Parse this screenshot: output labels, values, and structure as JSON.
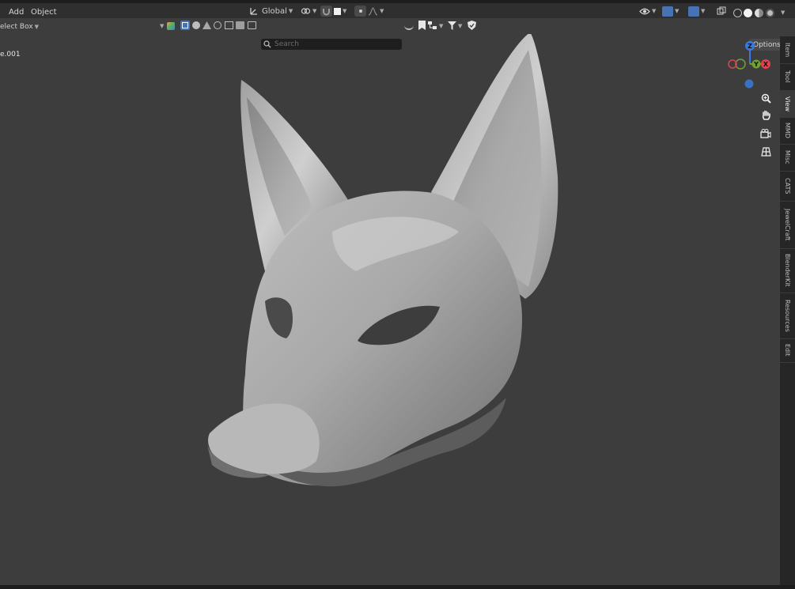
{
  "header": {
    "menu_add": "Add",
    "menu_object": "Object",
    "transform_orientation": "Global",
    "select_mode": "elect Box",
    "search_placeholder": "Search",
    "options_label": "Options"
  },
  "viewport": {
    "object_name": "e.001",
    "background_color": "#3d3d3d",
    "navigation_gizmo": {
      "z_label": "Z",
      "y_label": "Y",
      "x_label": "X",
      "x_color": "#e0414d",
      "y_color": "#6fa42a",
      "z_color": "#3b7ad9"
    }
  },
  "sidebar_tabs": [
    "Item",
    "Tool",
    "View",
    "MMD",
    "Misc",
    "CATS",
    "JewelCraft",
    "BlenderKit",
    "Resources",
    "Edit"
  ]
}
